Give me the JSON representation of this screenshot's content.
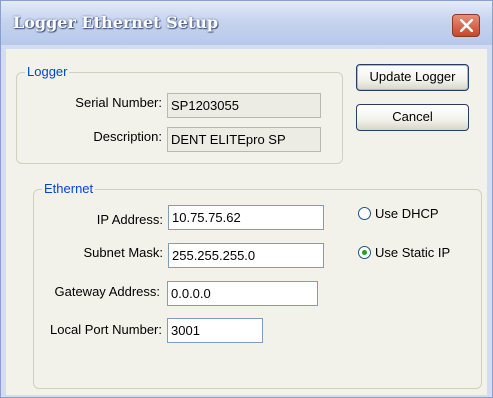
{
  "window": {
    "title": "Logger Ethernet Setup"
  },
  "logger_group": {
    "legend": "Logger",
    "serial_label": "Serial Number:",
    "serial_value": "SP1203055",
    "description_label": "Description:",
    "description_value": "DENT ELITEpro SP"
  },
  "buttons": {
    "update": "Update Logger",
    "cancel": "Cancel"
  },
  "ethernet_group": {
    "legend": "Ethernet",
    "ip_label": "IP Address:",
    "ip_value": "10.75.75.62",
    "subnet_label": "Subnet Mask:",
    "subnet_value": "255.255.255.0",
    "gateway_label": "Gateway Address:",
    "gateway_value": "0.0.0.0",
    "port_label": "Local Port Number:",
    "port_value": "3001",
    "dhcp_label": "Use DHCP",
    "static_label": "Use Static IP",
    "selected_mode": "static"
  },
  "colors": {
    "legend": "#0046d5",
    "close": "#c9452b",
    "radio_dot": "#21a121"
  }
}
